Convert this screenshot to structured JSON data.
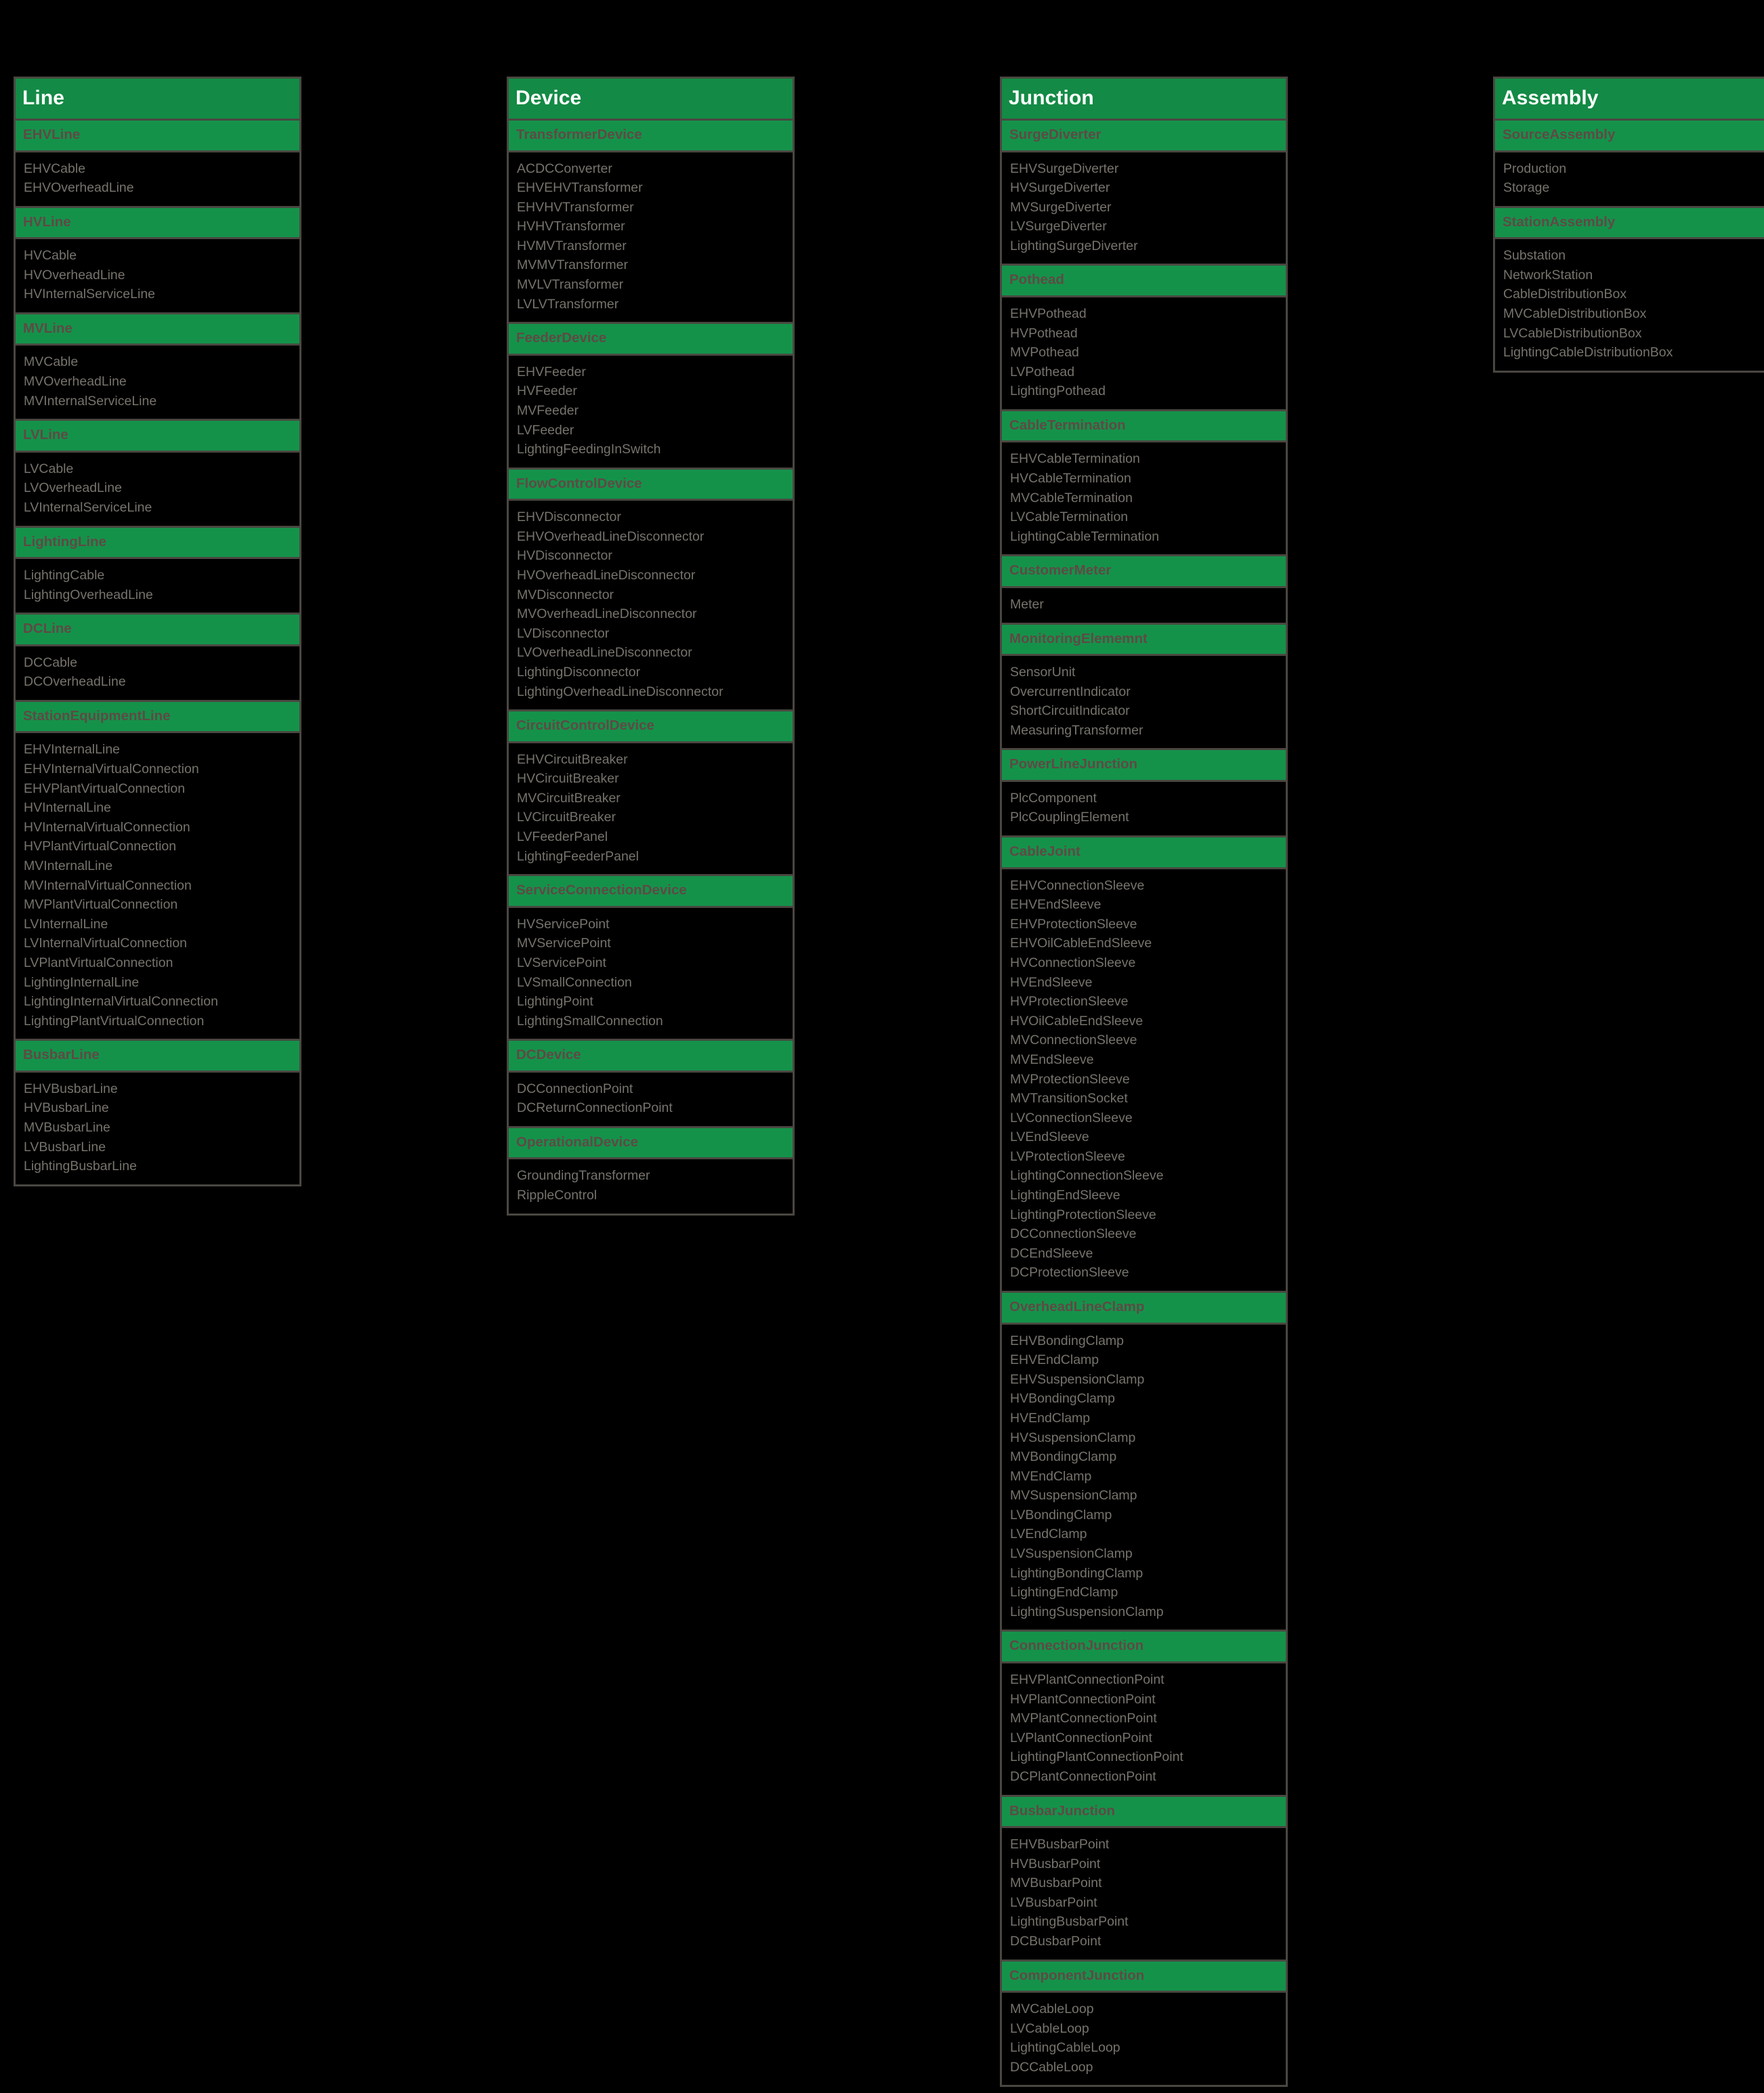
{
  "theme": {
    "background": "#000000",
    "panel_border": "#4a4741",
    "title_band": "#138a45",
    "group_band": "#15924a",
    "title_text": "#ffffff",
    "group_text": "#5e4a45",
    "item_text": "#77736c"
  },
  "columns": [
    {
      "title": "Line",
      "groups": [
        {
          "name": "EHVLine",
          "items": [
            "EHVCable",
            "EHVOverheadLine"
          ]
        },
        {
          "name": "HVLine",
          "items": [
            "HVCable",
            "HVOverheadLine",
            "HVInternalServiceLine"
          ]
        },
        {
          "name": "MVLine",
          "items": [
            "MVCable",
            "MVOverheadLine",
            "MVInternalServiceLine"
          ]
        },
        {
          "name": "LVLine",
          "items": [
            "LVCable",
            "LVOverheadLine",
            "LVInternalServiceLine"
          ]
        },
        {
          "name": "LightingLine",
          "items": [
            "LightingCable",
            "LightingOverheadLine"
          ]
        },
        {
          "name": "DCLine",
          "items": [
            "DCCable",
            "DCOverheadLine"
          ]
        },
        {
          "name": "StationEquipmentLine",
          "items": [
            "EHVInternalLine",
            "EHVInternalVirtualConnection",
            "EHVPlantVirtualConnection",
            "HVInternalLine",
            "HVInternalVirtualConnection",
            "HVPlantVirtualConnection",
            "MVInternalLine",
            "MVInternalVirtualConnection",
            "MVPlantVirtualConnection",
            "LVInternalLine",
            "LVInternalVirtualConnection",
            "LVPlantVirtualConnection",
            "LightingInternalLine",
            "LightingInternalVirtualConnection",
            "LightingPlantVirtualConnection"
          ]
        },
        {
          "name": "BusbarLine",
          "items": [
            "EHVBusbarLine",
            "HVBusbarLine",
            "MVBusbarLine",
            "LVBusbarLine",
            "LightingBusbarLine"
          ]
        }
      ]
    },
    {
      "title": "Device",
      "groups": [
        {
          "name": "TransformerDevice",
          "items": [
            "ACDCConverter",
            "EHVEHVTransformer",
            "EHVHVTransformer",
            "HVHVTransformer",
            "HVMVTransformer",
            "MVMVTransformer",
            "MVLVTransformer",
            "LVLVTransformer"
          ]
        },
        {
          "name": "FeederDevice",
          "items": [
            "EHVFeeder",
            "HVFeeder",
            "MVFeeder",
            "LVFeeder",
            "LightingFeedingInSwitch"
          ]
        },
        {
          "name": "FlowControlDevice",
          "items": [
            "EHVDisconnector",
            "EHVOverheadLineDisconnector",
            "HVDisconnector",
            "HVOverheadLineDisconnector",
            "MVDisconnector",
            "MVOverheadLineDisconnector",
            "LVDisconnector",
            "LVOverheadLineDisconnector",
            "LightingDisconnector",
            "LightingOverheadLineDisconnector"
          ]
        },
        {
          "name": "CircuitControlDevice",
          "items": [
            "EHVCircuitBreaker",
            "HVCircuitBreaker",
            "MVCircuitBreaker",
            "LVCircuitBreaker",
            "LVFeederPanel",
            "LightingFeederPanel"
          ]
        },
        {
          "name": "ServiceConnectionDevice",
          "items": [
            "HVServicePoint",
            "MVServicePoint",
            "LVServicePoint",
            "LVSmallConnection",
            "LightingPoint",
            "LightingSmallConnection"
          ]
        },
        {
          "name": "DCDevice",
          "items": [
            "DCConnectionPoint",
            "DCReturnConnectionPoint"
          ]
        },
        {
          "name": "OperationalDevice",
          "items": [
            "GroundingTransformer",
            "RippleControl"
          ]
        }
      ]
    },
    {
      "title": "Junction",
      "groups": [
        {
          "name": "SurgeDiverter",
          "items": [
            "EHVSurgeDiverter",
            "HVSurgeDiverter",
            "MVSurgeDiverter",
            "LVSurgeDiverter",
            "LightingSurgeDiverter"
          ]
        },
        {
          "name": "Pothead",
          "items": [
            "EHVPothead",
            "HVPothead",
            "MVPothead",
            "LVPothead",
            "LightingPothead"
          ]
        },
        {
          "name": "CableTermination",
          "items": [
            "EHVCableTermination",
            "HVCableTermination",
            "MVCableTermination",
            "LVCableTermination",
            "LightingCableTermination"
          ]
        },
        {
          "name": "CustomerMeter",
          "items": [
            "Meter"
          ]
        },
        {
          "name": "MonitoringElememnt",
          "items": [
            "SensorUnit",
            "OvercurrentIndicator",
            "ShortCircuitIndicator",
            "MeasuringTransformer"
          ]
        },
        {
          "name": "PowerLineJunction",
          "items": [
            "PlcComponent",
            "PlcCouplingElement"
          ]
        },
        {
          "name": "CableJoint",
          "items": [
            "EHVConnectionSleeve",
            "EHVEndSleeve",
            "EHVProtectionSleeve",
            "EHVOilCableEndSleeve",
            "HVConnectionSleeve",
            "HVEndSleeve",
            "HVProtectionSleeve",
            "HVOilCableEndSleeve",
            "MVConnectionSleeve",
            "MVEndSleeve",
            "MVProtectionSleeve",
            "MVTransitionSocket",
            "LVConnectionSleeve",
            "LVEndSleeve",
            "LVProtectionSleeve",
            "LightingConnectionSleeve",
            "LightingEndSleeve",
            "LightingProtectionSleeve",
            "DCConnectionSleeve",
            "DCEndSleeve",
            "DCProtectionSleeve"
          ]
        },
        {
          "name": "OverheadLineClamp",
          "items": [
            "EHVBondingClamp",
            "EHVEndClamp",
            "EHVSuspensionClamp",
            "HVBondingClamp",
            "HVEndClamp",
            "HVSuspensionClamp",
            "MVBondingClamp",
            "MVEndClamp",
            "MVSuspensionClamp",
            "LVBondingClamp",
            "LVEndClamp",
            "LVSuspensionClamp",
            "LightingBondingClamp",
            "LightingEndClamp",
            "LightingSuspensionClamp"
          ]
        },
        {
          "name": "ConnectionJunction",
          "items": [
            "EHVPlantConnectionPoint",
            "HVPlantConnectionPoint",
            "MVPlantConnectionPoint",
            "LVPlantConnectionPoint",
            "LightingPlantConnectionPoint",
            "DCPlantConnectionPoint"
          ]
        },
        {
          "name": "BusbarJunction",
          "items": [
            "EHVBusbarPoint",
            "HVBusbarPoint",
            "MVBusbarPoint",
            "LVBusbarPoint",
            "LightingBusbarPoint",
            "DCBusbarPoint"
          ]
        },
        {
          "name": "ComponentJunction",
          "items": [
            "MVCableLoop",
            "LVCableLoop",
            "LightingCableLoop",
            "DCCableLoop"
          ]
        }
      ]
    },
    {
      "title": "Assembly",
      "groups": [
        {
          "name": "SourceAssembly",
          "items": [
            "Production",
            "Storage"
          ]
        },
        {
          "name": "StationAssembly",
          "items": [
            "Substation",
            "NetworkStation",
            "CableDistributionBox",
            "MVCableDistributionBox",
            "LVCableDistributionBox",
            "LightingCableDistributionBox"
          ]
        }
      ]
    }
  ]
}
